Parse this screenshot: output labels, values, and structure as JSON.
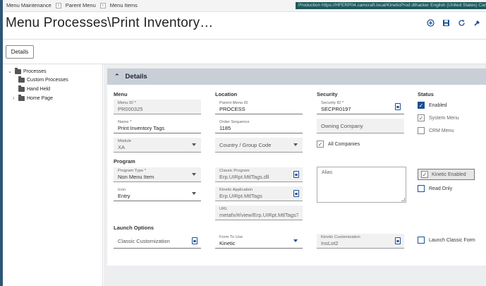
{
  "breadcrumbs": [
    "Menu Maintenance",
    "Parent Menu",
    "Menu Items"
  ],
  "env_bar": "Production   https://HFERP04.camcraft.local/KineticProd    dthacker   English (United States)   Camc",
  "page_title": "Menu Processes\\Print Inventory…",
  "header_icons": [
    "add-icon",
    "save-icon",
    "refresh-icon",
    "clear-icon"
  ],
  "details_button": "Details",
  "tree": {
    "root": "Processes",
    "children": [
      "Custom Processes",
      "Hand Held",
      "Home Page"
    ]
  },
  "panel_title": "Details",
  "sections": {
    "menu": "Menu",
    "location": "Location",
    "security": "Security",
    "status": "Status",
    "program": "Program",
    "launch": "Launch Options"
  },
  "fields": {
    "menu_id": {
      "label": "Menu ID *",
      "value": "PR000325"
    },
    "name": {
      "label": "Name *",
      "value": "Print Inventory Tags"
    },
    "module": {
      "label": "Module",
      "value": "XA"
    },
    "parent_menu_id": {
      "label": "Parent Menu ID",
      "value": "PROCESS"
    },
    "order_sequence": {
      "label": "Order Sequence",
      "value": "1185"
    },
    "country_group_code": {
      "placeholder": "Country / Group Code"
    },
    "security_id": {
      "label": "Security ID *",
      "value": "SECPR0197"
    },
    "owning_company": {
      "placeholder": "Owning Company"
    },
    "program_type": {
      "label": "Program Type *",
      "value": "Non Menu Item"
    },
    "icon": {
      "label": "Icon",
      "value": "Entry"
    },
    "classic_program": {
      "label": "Classic Program",
      "value": "Erp.UIRpt.MtlTags.dll"
    },
    "kinetic_application": {
      "label": "Kinetic Application",
      "value": "Erp.UIRpt.MtlTags"
    },
    "url": {
      "label": "URL",
      "value": "metafx/#/view/Erp.UIRpt.MtlTags?la..."
    },
    "alias": {
      "placeholder": "Alias"
    },
    "classic_customization": {
      "placeholder": "Classic Customization"
    },
    "form_to_use": {
      "label": "Form To Use",
      "value": "Kinetic"
    },
    "kinetic_customization": {
      "label": "Kinetic Customization",
      "value": "InsLot2"
    }
  },
  "checkboxes": {
    "enabled": {
      "label": "Enabled",
      "checked": true
    },
    "system_menu": {
      "label": "System Menu",
      "checked": true
    },
    "crm_menu": {
      "label": "CRM Menu",
      "checked": false
    },
    "all_companies": {
      "label": "All Companies",
      "checked": true
    },
    "kinetic_enabled": {
      "label": "Kinetic Enabled",
      "checked": true
    },
    "read_only": {
      "label": "Read Only",
      "checked": false
    },
    "launch_classic_form": {
      "label": "Launch Classic Form",
      "checked": false
    }
  },
  "colors": {
    "accent": "#1d4f91",
    "left_edge": "#2b5876",
    "panel_header": "#c8cfd6",
    "env_bar": "#1e5a5a"
  }
}
